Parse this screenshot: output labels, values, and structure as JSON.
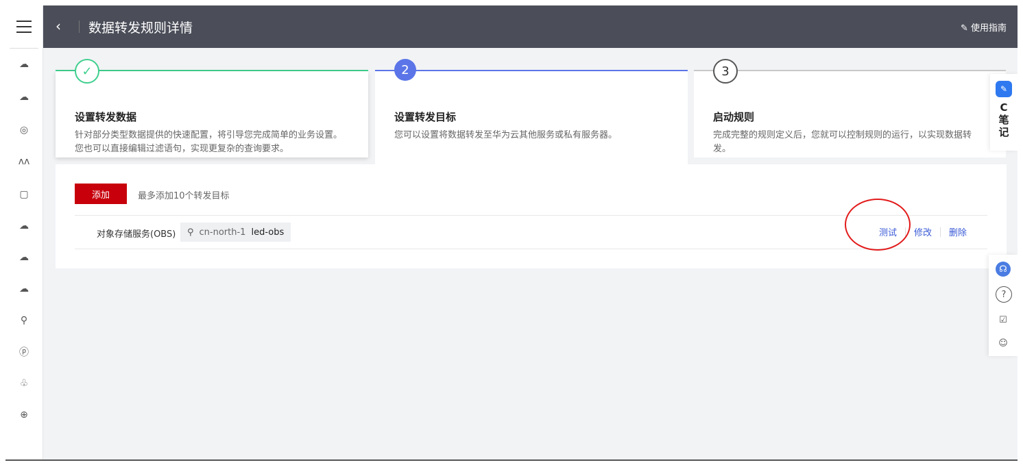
{
  "header": {
    "title": "数据转发规则详情",
    "guide": "使用指南"
  },
  "steps": [
    {
      "num": "✓",
      "title": "设置转发数据",
      "desc": "针对部分类型数据提供的快速配置，将引导您完成简单的业务设置。您也可以直接编辑过滤语句，实现更复杂的查询要求。",
      "status": "done",
      "color": "#3ecf8e"
    },
    {
      "num": "2",
      "title": "设置转发目标",
      "desc": "您可以设置将数据转发至华为云其他服务或私有服务器。",
      "status": "active",
      "color": "#5b75e8"
    },
    {
      "num": "3",
      "title": "启动规则",
      "desc": "完成完整的规则定义后，您就可以控制规则的运行，以实现数据转发。",
      "status": "pending",
      "color": "#9b9b9b"
    }
  ],
  "panel": {
    "add_label": "添加",
    "hint": "最多添加10个转发目标"
  },
  "target": {
    "service": "对象存储服务(OBS)",
    "region": "cn-north-1",
    "bucket": "led-obs",
    "actions": {
      "test": "测试",
      "edit": "修改",
      "delete": "删除"
    }
  },
  "note": {
    "badge": "✎",
    "text_c": "C",
    "text_1": "笔",
    "text_2": "记"
  },
  "sidebar_icons": [
    "cloud-server-icon",
    "cloud-dots-icon",
    "database-icon",
    "waveform-icon",
    "device-icon",
    "cloud-outline-icon",
    "cloud-upload-icon",
    "cloud-speed-icon",
    "antenna-icon",
    "ip-icon",
    "cluster-icon",
    "globe-icon"
  ]
}
